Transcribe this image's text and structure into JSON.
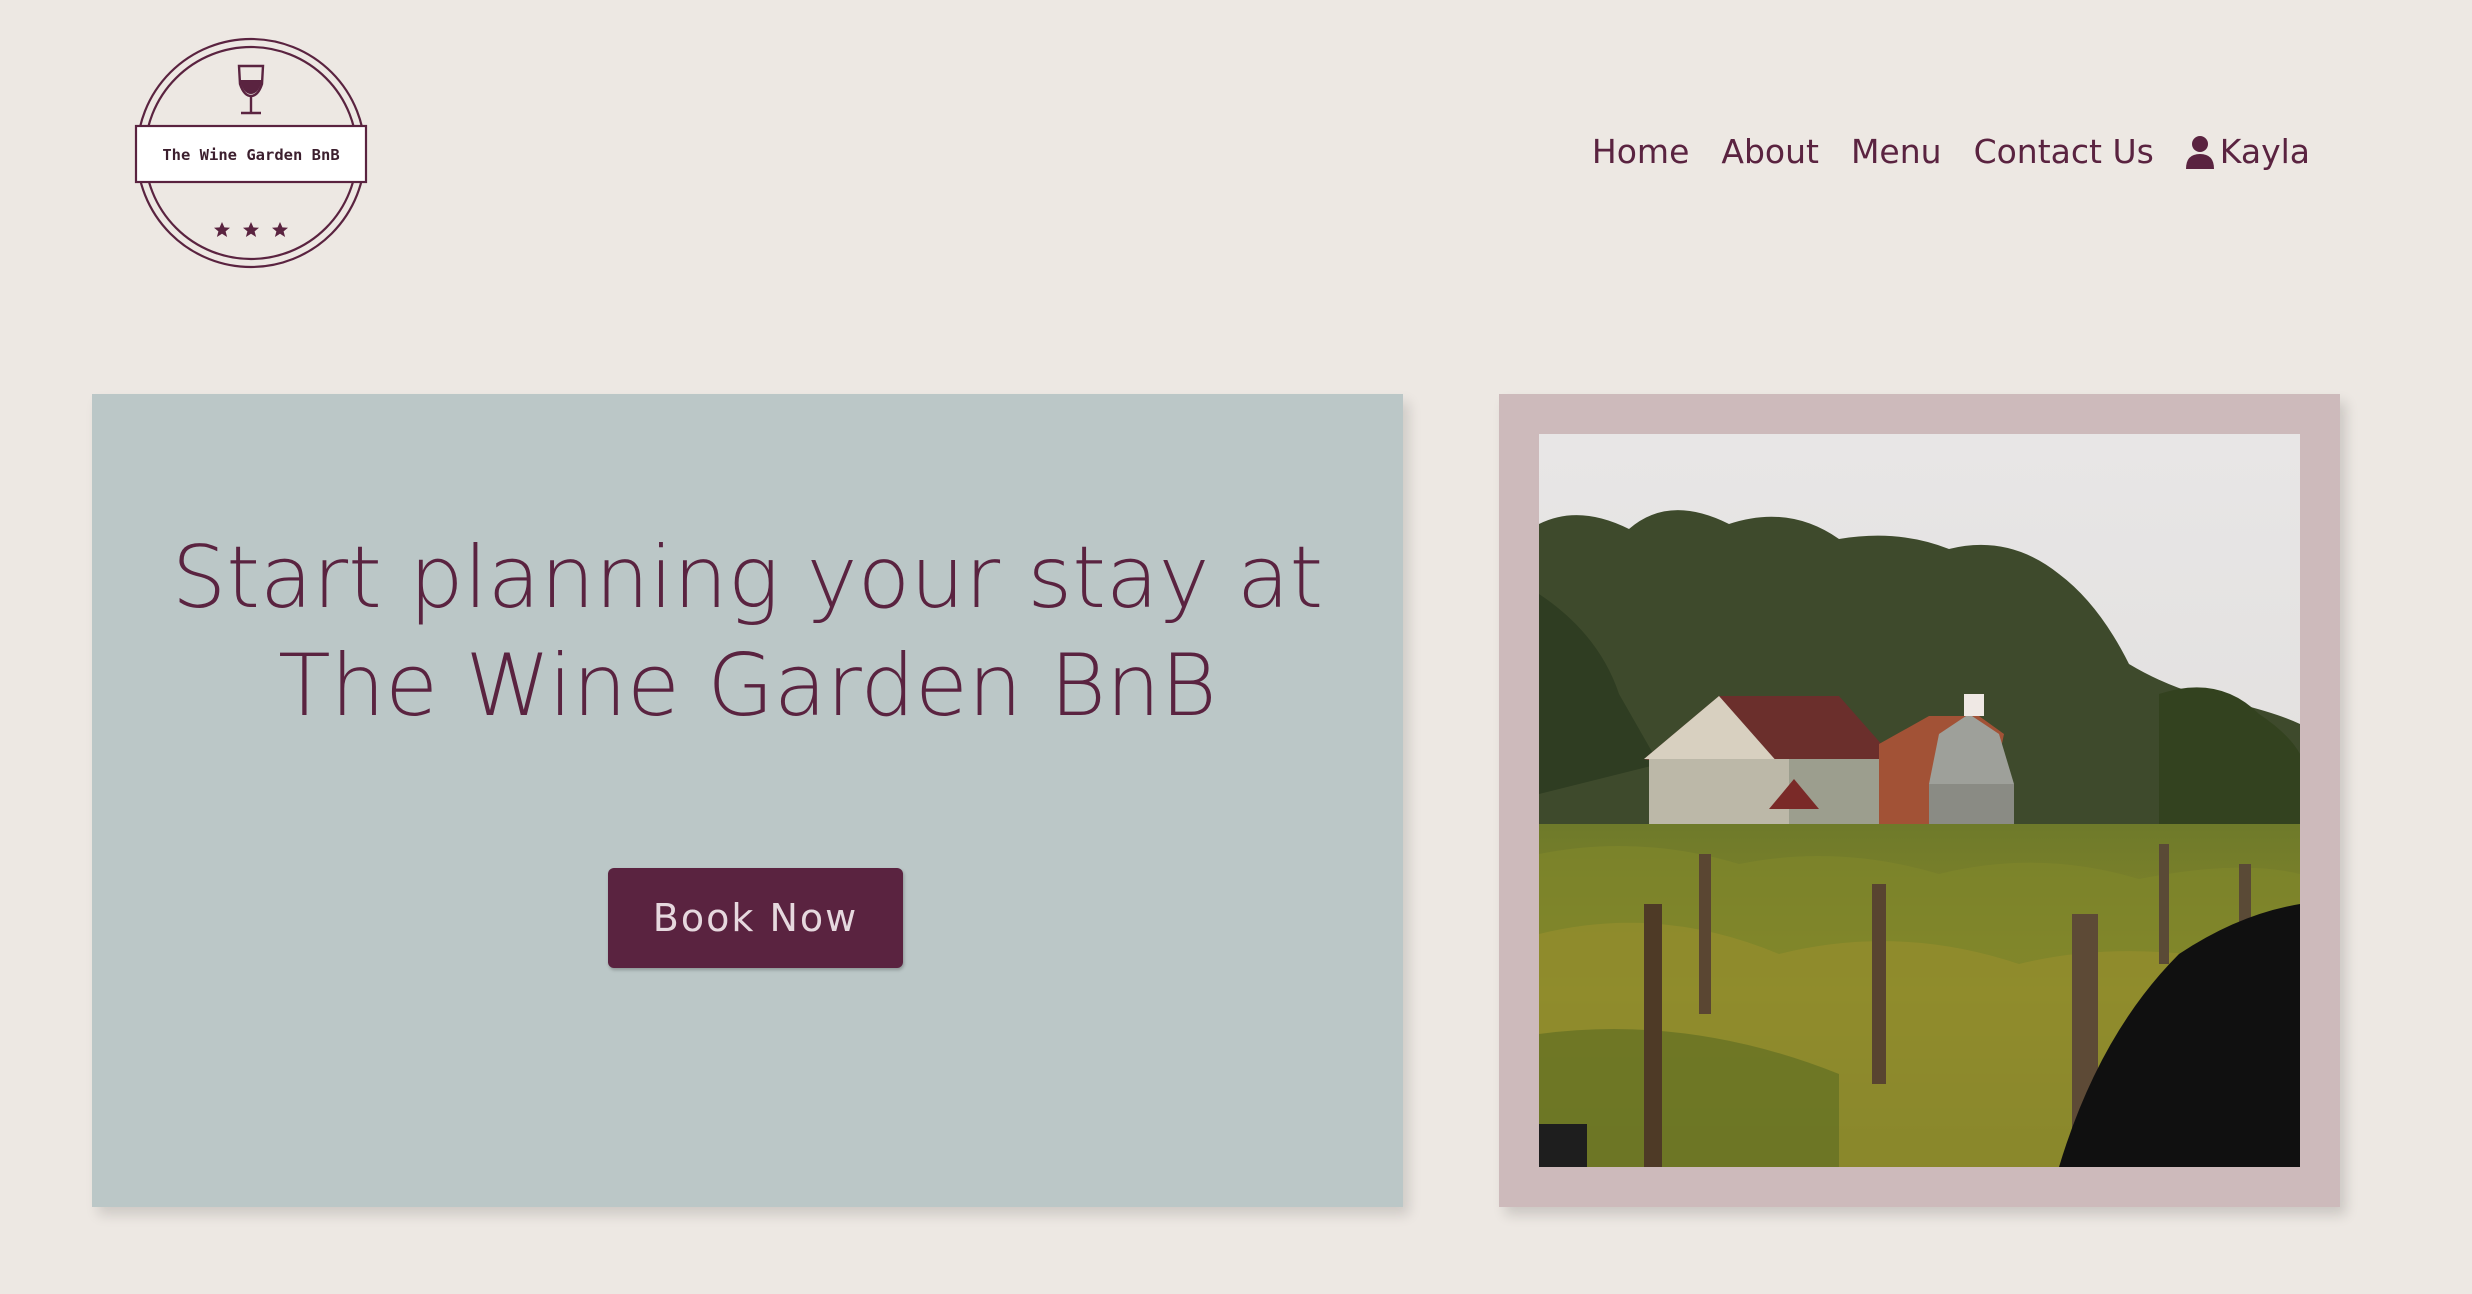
{
  "brand": {
    "logo_text": "The Wine Garden BnB",
    "logo_icon": "wine-glass-icon",
    "stars_icon": "star-icon"
  },
  "nav": {
    "items": [
      {
        "label": "Home"
      },
      {
        "label": "About"
      },
      {
        "label": "Menu"
      },
      {
        "label": "Contact Us"
      }
    ],
    "user": {
      "icon": "user-icon",
      "name": "Kayla"
    }
  },
  "hero": {
    "title_line1": "Start planning your stay at",
    "title_line2": "The Wine Garden BnB",
    "cta_label": "Book Now"
  },
  "colors": {
    "background": "#ede8e3",
    "accent": "#5a2340",
    "hero_panel": "#bbc7c7",
    "photo_frame": "#cdbabb"
  }
}
